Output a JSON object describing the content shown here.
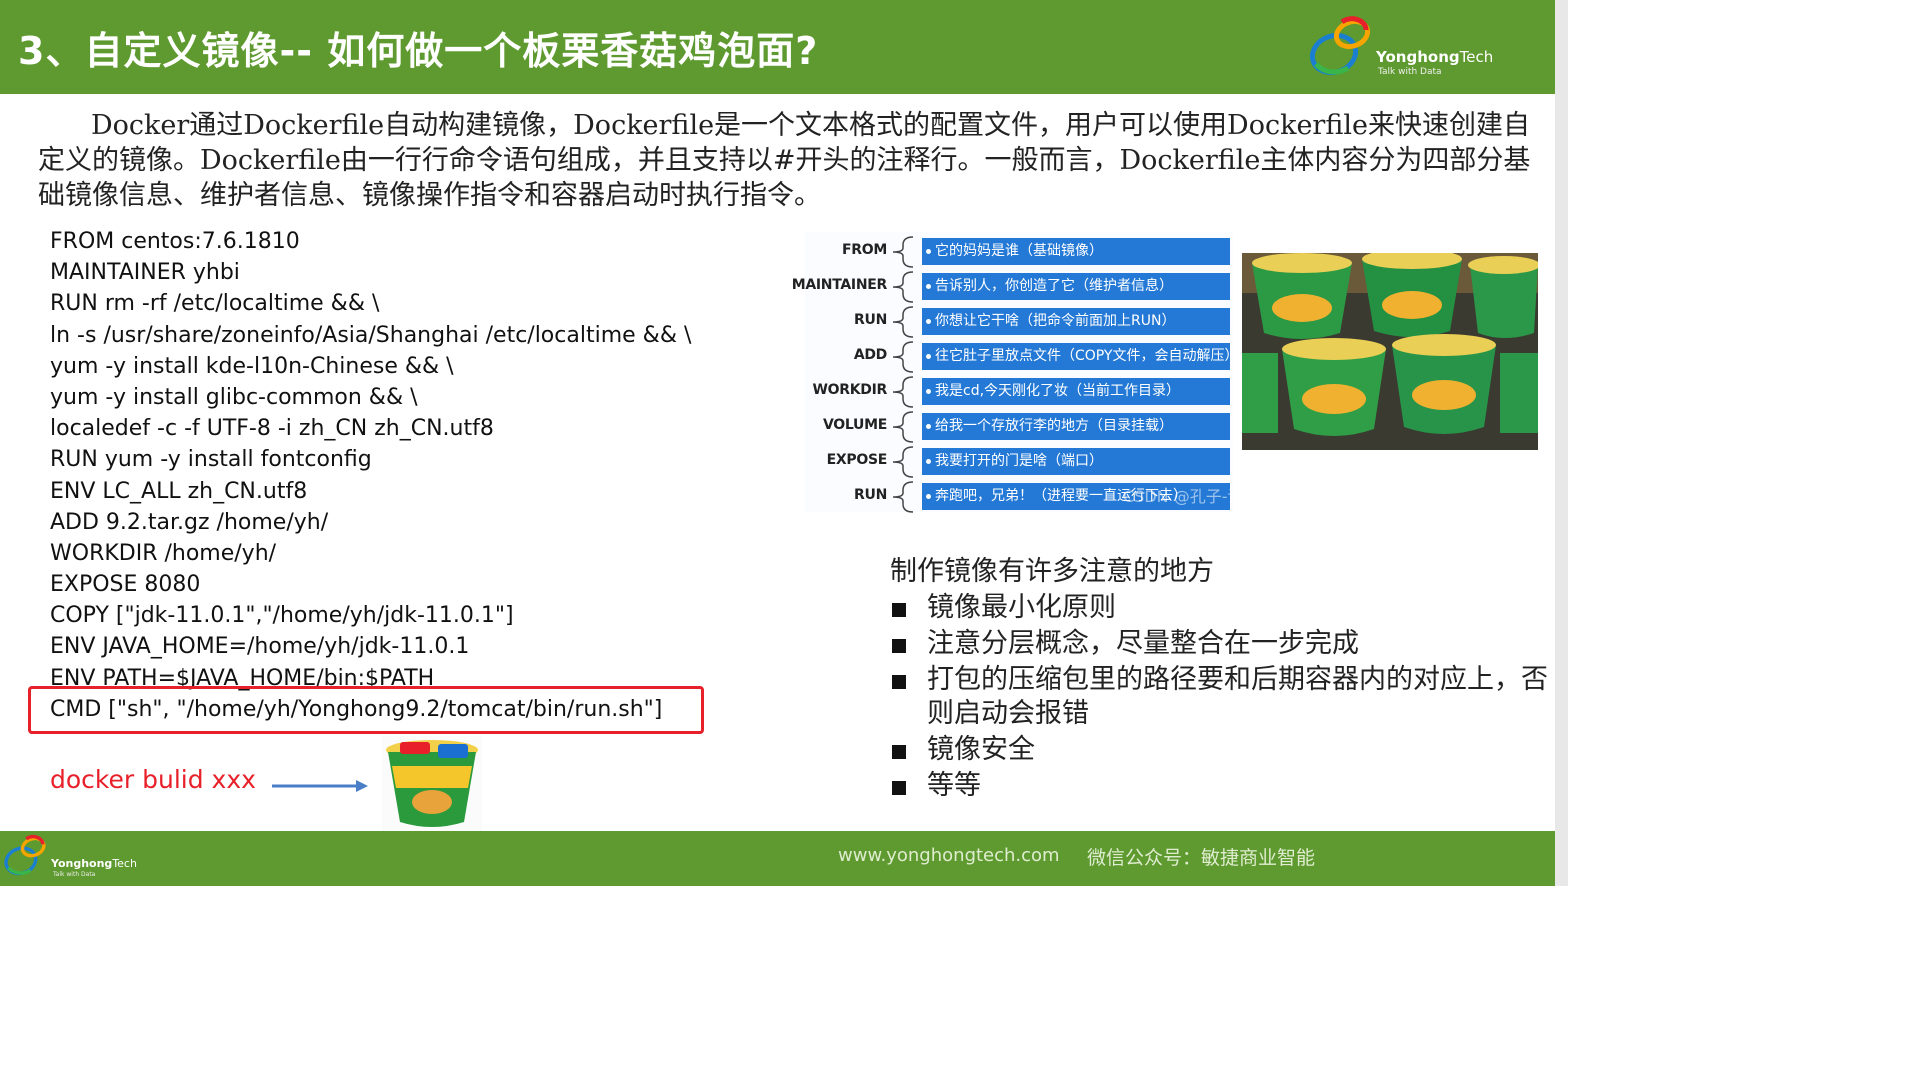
{
  "header": {
    "title": "3、自定义镜像-- 如何做一个板栗香菇鸡泡面?",
    "brand": "Yonghong",
    "brand_suffix": "Tech",
    "tagline": "Talk with Data"
  },
  "intro": "Docker通过Dockerfile自动构建镜像，Dockerfile是一个文本格式的配置文件，用户可以使用Dockerfile来快速创建自定义的镜像。Dockerfile由一行行命令语句组成，并且支持以#开头的注释行。一般而言，Dockerfile主体内容分为四部分基础镜像信息、维护者信息、镜像操作指令和容器启动时执行指令。",
  "dockerfile": [
    "FROM centos:7.6.1810",
    "MAINTAINER yhbi",
    "RUN rm -rf /etc/localtime && \\",
    "ln -s /usr/share/zoneinfo/Asia/Shanghai /etc/localtime && \\",
    "yum -y install kde-l10n-Chinese && \\",
    "yum -y install glibc-common && \\",
    "localedef -c -f UTF-8 -i zh_CN zh_CN.utf8",
    "RUN yum -y install fontconfig",
    "ENV LC_ALL zh_CN.utf8",
    "ADD 9.2.tar.gz /home/yh/",
    "WORKDIR /home/yh/",
    "EXPOSE 8080",
    "COPY [\"jdk-11.0.1\",\"/home/yh/jdk-11.0.1\"]",
    "ENV JAVA_HOME=/home/yh/jdk-11.0.1",
    "ENV PATH=$JAVA_HOME/bin:$PATH",
    "CMD [\"sh\", \"/home/yh/Yonghong9.2/tomcat/bin/run.sh\"]"
  ],
  "build_command": "docker bulid xxx",
  "mapping": [
    {
      "key": "FROM",
      "desc": "它的妈妈是谁（基础镜像）"
    },
    {
      "key": "MAINTAINER",
      "desc": "告诉别人，你创造了它（维护者信息）"
    },
    {
      "key": "RUN",
      "desc": "你想让它干啥（把命令前面加上RUN）"
    },
    {
      "key": "ADD",
      "desc": "往它肚子里放点文件（COPY文件，会自动解压）"
    },
    {
      "key": "WORKDIR",
      "desc": "我是cd,今天刚化了妆（当前工作目录）"
    },
    {
      "key": "VOLUME",
      "desc": "给我一个存放行李的地方（目录挂载）"
    },
    {
      "key": "EXPOSE",
      "desc": "我要打开的门是啥（端口）"
    },
    {
      "key": "RUN",
      "desc": "奔跑吧，兄弟！（进程要一直运行下去）"
    }
  ],
  "watermark": "CSDN @孔子-说",
  "notes": {
    "title": "制作镜像有许多注意的地方",
    "items": [
      "镜像最小化原则",
      "注意分层概念，尽量整合在一步完成",
      "打包的压缩包里的路径要和后期容器内的对应上，否则启动会报错",
      "镜像安全",
      "等等"
    ]
  },
  "footer": {
    "site": "www.yonghongtech.com",
    "wechat": "微信公众号：敏捷商业智能"
  },
  "colors": {
    "brand_green": "#5e9a2f",
    "box_blue": "#2479d6",
    "highlight_red": "#e8202a"
  }
}
